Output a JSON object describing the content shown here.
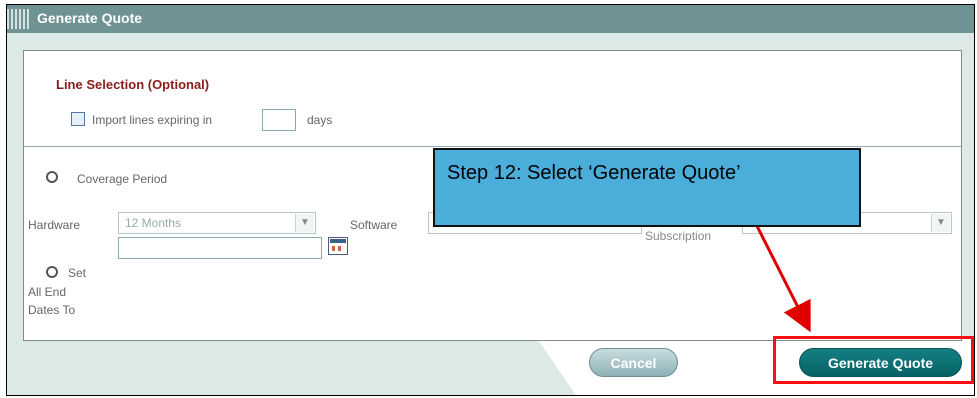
{
  "window": {
    "title": "Generate Quote"
  },
  "line_selection": {
    "title": "Line Selection (Optional)",
    "checkbox_label": "Import lines expiring in",
    "days_value": "",
    "days_label": "days"
  },
  "coverage": {
    "radio_label": "Coverage Period",
    "hardware_label": "Hardware",
    "hardware_value": "12 Months",
    "software_label": "Software",
    "subscription_label": "Subscription"
  },
  "set_end_dates": {
    "radio_label": "Set",
    "label_line2": "All End",
    "label_line3": "Dates To",
    "date_value": ""
  },
  "buttons": {
    "cancel_label": "Cancel",
    "generate_label": "Generate Quote"
  },
  "callout": {
    "text": "Step 12: Select ‘Generate Quote’"
  },
  "colors": {
    "titlebar": "#6f9394",
    "accent": "#0b6f73",
    "highlight": "#ff1010",
    "callout": "#4badd9"
  },
  "icons": {
    "calendar": "calendar-icon",
    "dropdown": "chevron-down-icon",
    "arrow": "annotation-arrow"
  }
}
